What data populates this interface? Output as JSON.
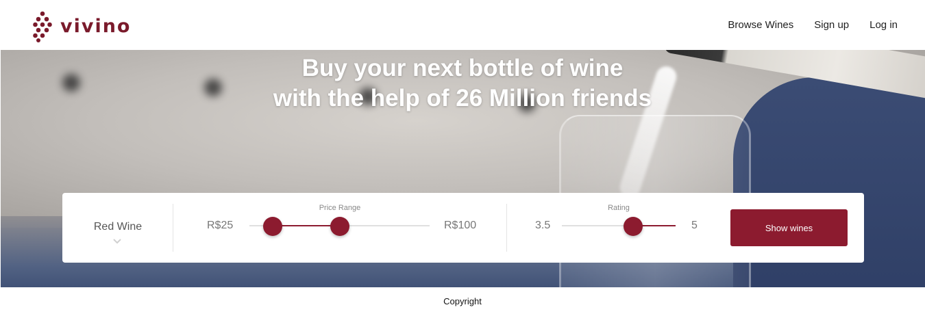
{
  "header": {
    "logo_text": "vivino",
    "nav": [
      "Browse Wines",
      "Sign up",
      "Log in"
    ]
  },
  "hero": {
    "title_line1": "Buy your next bottle of wine",
    "title_line2": "with the help of 26 Million friends"
  },
  "filter": {
    "wine_type": "Red Wine",
    "price": {
      "label": "Price Range",
      "min": "R$25",
      "max": "R$100",
      "low_fraction": 0.13,
      "high_fraction": 0.5
    },
    "rating": {
      "label": "Rating",
      "min": "3.5",
      "max": "5",
      "value_fraction": 0.63
    },
    "button": "Show wines"
  },
  "footer": {
    "text": "Copyright"
  },
  "colors": {
    "brand": "#7a1a2b",
    "accent": "#8c1b2f"
  },
  "icons": [
    "grape-logo-icon",
    "chevron-down-icon"
  ]
}
